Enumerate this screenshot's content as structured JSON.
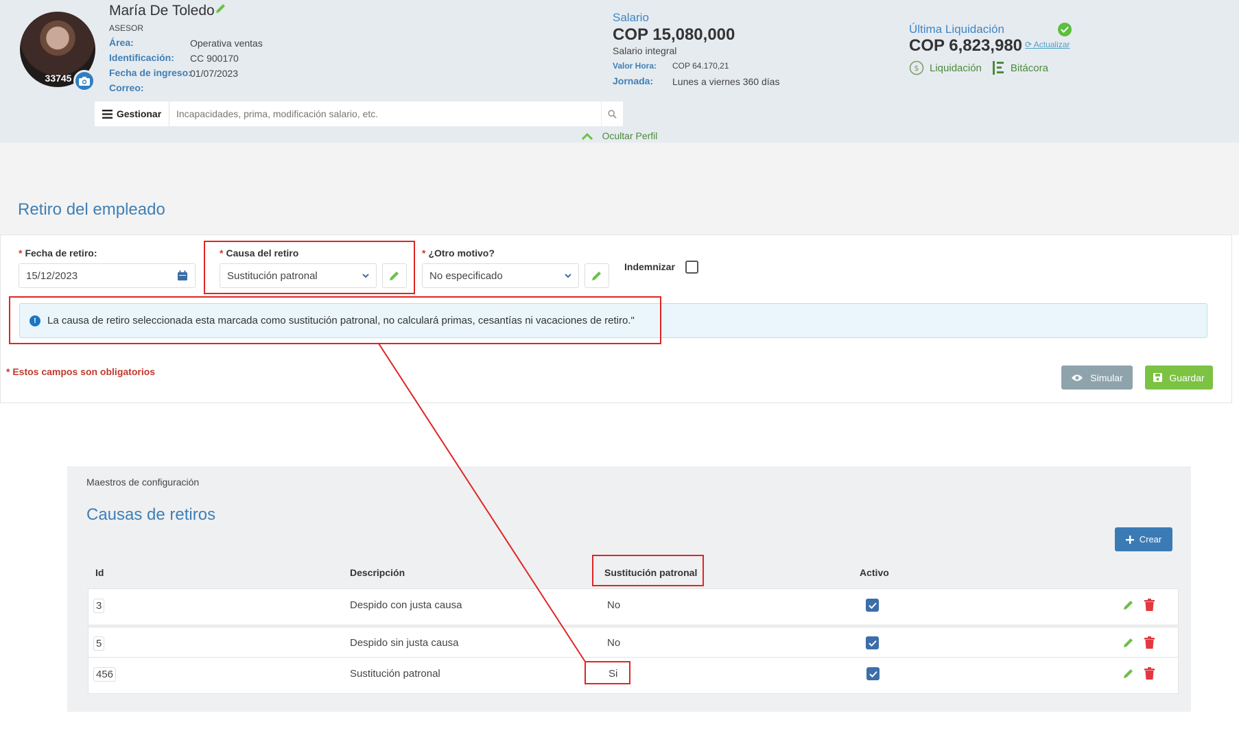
{
  "profile": {
    "name": "María De Toledo",
    "role": "ASESOR",
    "badge_id": "33745",
    "fields": [
      {
        "label": "Área:",
        "value": "Operativa ventas"
      },
      {
        "label": "Identificación:",
        "value": "CC 900170"
      },
      {
        "label": "Fecha de ingreso:",
        "value": "01/07/2023"
      },
      {
        "label": "Correo:",
        "value": ""
      }
    ],
    "gestionar_label": "Gestionar",
    "search_placeholder": "Incapacidades, prima, modificación salario, etc.",
    "hide_profile": "Ocultar Perfil"
  },
  "salary": {
    "label": "Salario",
    "value": "COP 15,080,000",
    "type": "Salario integral",
    "hour_label": "Valor Hora:",
    "hour_value": "COP 64.170,21",
    "shift_label": "Jornada:",
    "shift_value": "Lunes a viernes 360 días"
  },
  "liquidation": {
    "label": "Última Liquidación",
    "value": "COP 6,823,980",
    "update_label": "Actualizar",
    "link_liquidacion": "Liquidación",
    "link_bitacora": "Bitácora"
  },
  "retiro": {
    "title": "Retiro del empleado",
    "fecha_label": "Fecha de retiro:",
    "fecha_value": "15/12/2023",
    "causa_label": "Causa del retiro",
    "causa_value": "Sustitución patronal",
    "otro_label": "¿Otro motivo?",
    "otro_value": "No especificado",
    "indemnizar_label": "Indemnizar",
    "alert_text": "La causa de retiro seleccionada esta marcada como sustitución patronal, no calculará primas, cesantías ni vacaciones de retiro.\"",
    "required_note": "* Estos campos son obligatorios",
    "simular_label": "Simular",
    "guardar_label": "Guardar"
  },
  "causas": {
    "breadcrumb": "Maestros de configuración",
    "title": "Causas de retiros",
    "crear_label": "Crear",
    "columns": {
      "id": "Id",
      "descripcion": "Descripción",
      "sustitucion": "Sustitución patronal",
      "activo": "Activo"
    },
    "rows": [
      {
        "id": "3",
        "descripcion": "Despido con justa causa",
        "sustitucion": "No",
        "activo": true
      },
      {
        "id": "5",
        "descripcion": "Despido sin justa causa",
        "sustitucion": "No",
        "activo": true
      },
      {
        "id": "456",
        "descripcion": "Sustitución patronal",
        "sustitucion": "Si",
        "activo": true
      }
    ]
  },
  "colors": {
    "accent_blue": "#3f7fb6",
    "accent_green": "#7cc243",
    "annotation_red": "#e02424",
    "header_bg": "#e6ebf0"
  }
}
